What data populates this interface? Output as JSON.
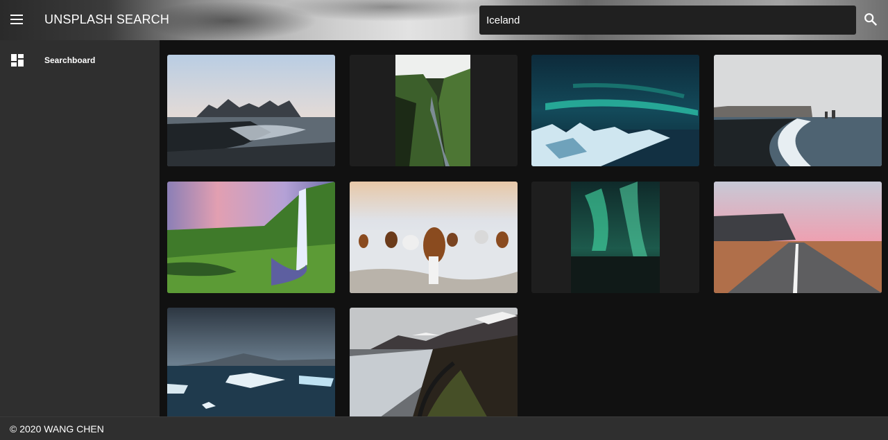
{
  "app": {
    "title": "UNSPLASH SEARCH"
  },
  "header": {
    "menu_icon": "hamburger-menu-icon",
    "search_value": "Iceland",
    "search_icon": "search-icon"
  },
  "sidebar": {
    "items": [
      {
        "label": "Searchboard",
        "icon": "dashboard-icon"
      }
    ]
  },
  "results": [
    {
      "subject": "mountain-beach"
    },
    {
      "subject": "green-canyon"
    },
    {
      "subject": "aurora-ice"
    },
    {
      "subject": "black-sand-beach"
    },
    {
      "subject": "waterfall"
    },
    {
      "subject": "horses"
    },
    {
      "subject": "aurora-green"
    },
    {
      "subject": "road-cliff"
    },
    {
      "subject": "glacier-lagoon"
    },
    {
      "subject": "mountain-road"
    }
  ],
  "footer": {
    "text": "© 2020 WANG CHEN"
  }
}
